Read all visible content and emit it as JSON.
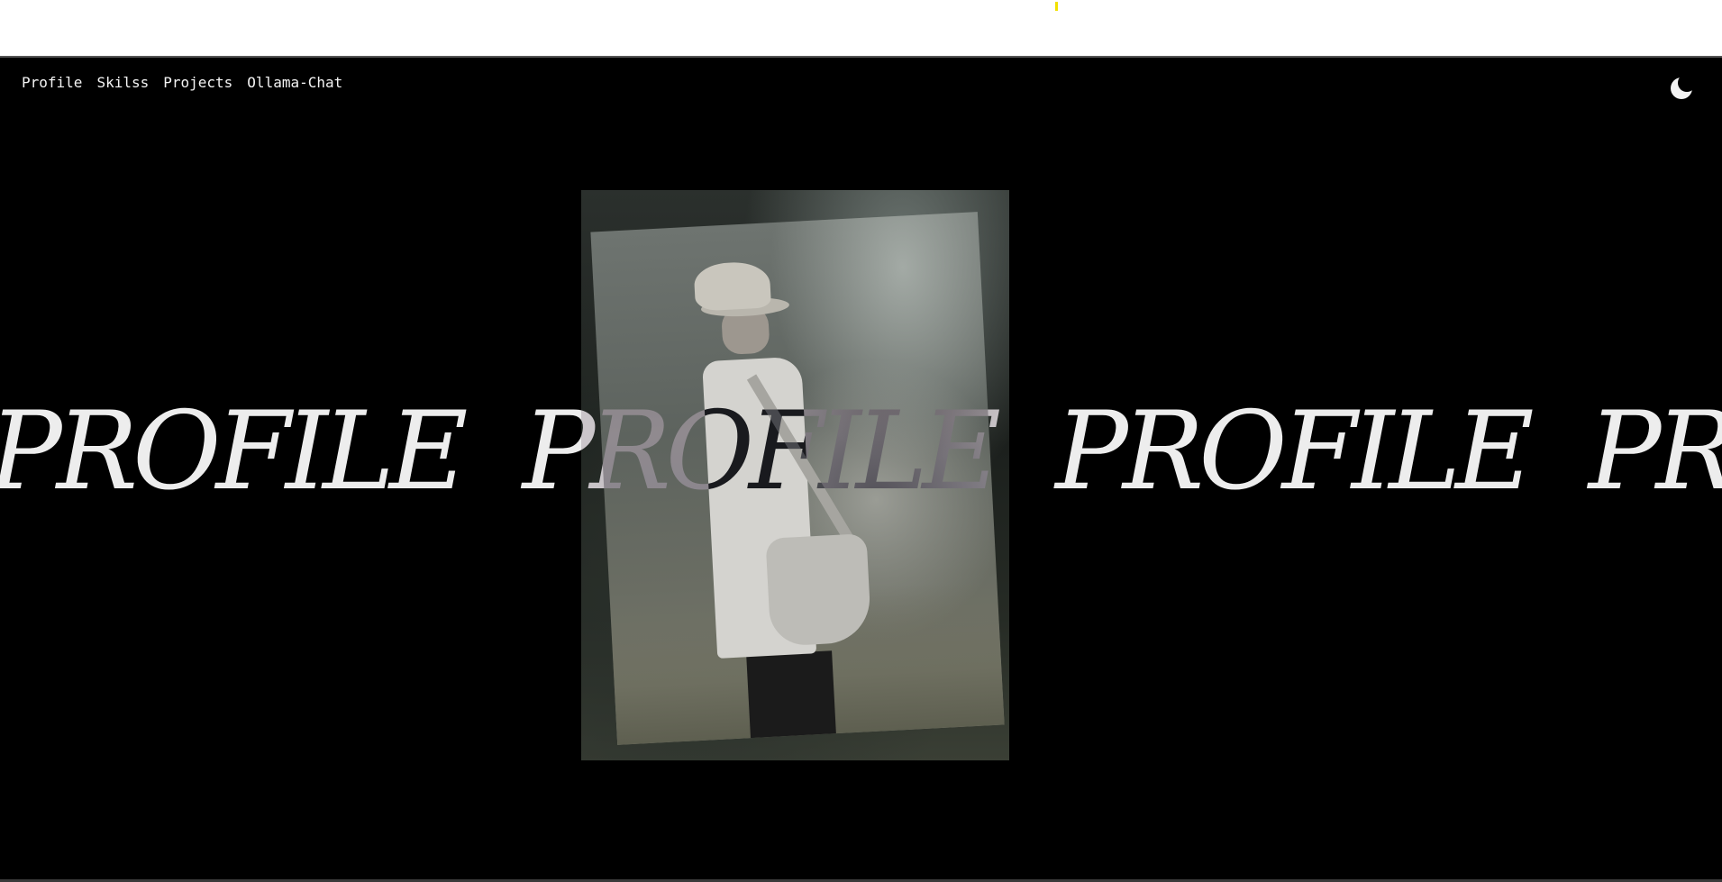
{
  "nav": {
    "items": [
      {
        "label": "Profile"
      },
      {
        "label": "Skilss"
      },
      {
        "label": "Projects"
      },
      {
        "label": "Ollama-Chat"
      }
    ]
  },
  "theme_toggle": {
    "icon": "moon-icon"
  },
  "hero": {
    "marquee_words": [
      "PROFILE",
      "PROFILE",
      "PROFILE",
      "PROFILE"
    ]
  },
  "colors": {
    "background": "#000000",
    "text": "#f4f4f4",
    "marquee": "#ededed",
    "top_marker": "#f2e100"
  }
}
